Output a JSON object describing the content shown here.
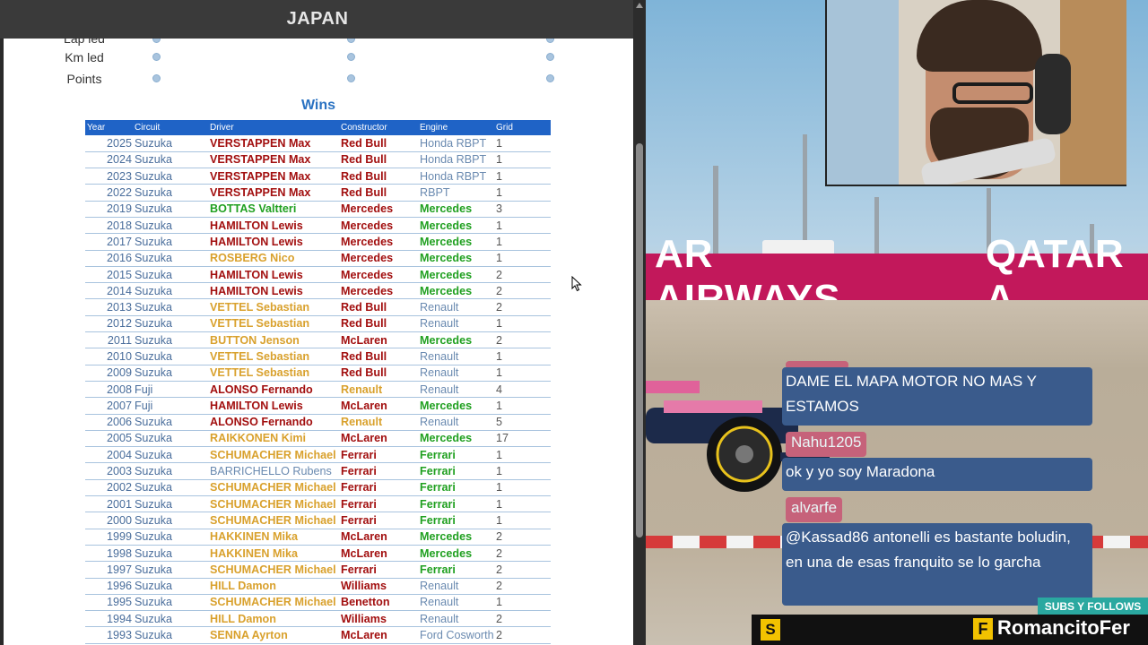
{
  "page": {
    "title": "JAPAN",
    "partial_label": "Lap led",
    "stats_rows": [
      {
        "label": "Km led"
      },
      {
        "label": "Points"
      }
    ],
    "wins_title": "Wins"
  },
  "wins_table": {
    "headers": [
      "Year",
      "Circuit",
      "Driver",
      "Constructor",
      "Engine",
      "Grid"
    ],
    "rows": [
      {
        "year": "2025",
        "circuit": "Suzuka",
        "driver": "VERSTAPPEN Max",
        "dc": "red",
        "constructor": "Red Bull",
        "cc": "red",
        "engine": "Honda RBPT",
        "ec": "blue",
        "grid": "1"
      },
      {
        "year": "2024",
        "circuit": "Suzuka",
        "driver": "VERSTAPPEN Max",
        "dc": "red",
        "constructor": "Red Bull",
        "cc": "red",
        "engine": "Honda RBPT",
        "ec": "blue",
        "grid": "1"
      },
      {
        "year": "2023",
        "circuit": "Suzuka",
        "driver": "VERSTAPPEN Max",
        "dc": "red",
        "constructor": "Red Bull",
        "cc": "red",
        "engine": "Honda RBPT",
        "ec": "blue",
        "grid": "1"
      },
      {
        "year": "2022",
        "circuit": "Suzuka",
        "driver": "VERSTAPPEN Max",
        "dc": "red",
        "constructor": "Red Bull",
        "cc": "red",
        "engine": "RBPT",
        "ec": "blue",
        "grid": "1"
      },
      {
        "year": "2019",
        "circuit": "Suzuka",
        "driver": "BOTTAS Valtteri",
        "dc": "green",
        "constructor": "Mercedes",
        "cc": "red",
        "engine": "Mercedes",
        "ec": "green",
        "grid": "3"
      },
      {
        "year": "2018",
        "circuit": "Suzuka",
        "driver": "HAMILTON Lewis",
        "dc": "red",
        "constructor": "Mercedes",
        "cc": "red",
        "engine": "Mercedes",
        "ec": "green",
        "grid": "1"
      },
      {
        "year": "2017",
        "circuit": "Suzuka",
        "driver": "HAMILTON Lewis",
        "dc": "red",
        "constructor": "Mercedes",
        "cc": "red",
        "engine": "Mercedes",
        "ec": "green",
        "grid": "1"
      },
      {
        "year": "2016",
        "circuit": "Suzuka",
        "driver": "ROSBERG Nico",
        "dc": "gold",
        "constructor": "Mercedes",
        "cc": "red",
        "engine": "Mercedes",
        "ec": "green",
        "grid": "1"
      },
      {
        "year": "2015",
        "circuit": "Suzuka",
        "driver": "HAMILTON Lewis",
        "dc": "red",
        "constructor": "Mercedes",
        "cc": "red",
        "engine": "Mercedes",
        "ec": "green",
        "grid": "2"
      },
      {
        "year": "2014",
        "circuit": "Suzuka",
        "driver": "HAMILTON Lewis",
        "dc": "red",
        "constructor": "Mercedes",
        "cc": "red",
        "engine": "Mercedes",
        "ec": "green",
        "grid": "2"
      },
      {
        "year": "2013",
        "circuit": "Suzuka",
        "driver": "VETTEL Sebastian",
        "dc": "gold",
        "constructor": "Red Bull",
        "cc": "red",
        "engine": "Renault",
        "ec": "blue",
        "grid": "2"
      },
      {
        "year": "2012",
        "circuit": "Suzuka",
        "driver": "VETTEL Sebastian",
        "dc": "gold",
        "constructor": "Red Bull",
        "cc": "red",
        "engine": "Renault",
        "ec": "blue",
        "grid": "1"
      },
      {
        "year": "2011",
        "circuit": "Suzuka",
        "driver": "BUTTON Jenson",
        "dc": "gold",
        "constructor": "McLaren",
        "cc": "red",
        "engine": "Mercedes",
        "ec": "green",
        "grid": "2"
      },
      {
        "year": "2010",
        "circuit": "Suzuka",
        "driver": "VETTEL Sebastian",
        "dc": "gold",
        "constructor": "Red Bull",
        "cc": "red",
        "engine": "Renault",
        "ec": "blue",
        "grid": "1"
      },
      {
        "year": "2009",
        "circuit": "Suzuka",
        "driver": "VETTEL Sebastian",
        "dc": "gold",
        "constructor": "Red Bull",
        "cc": "red",
        "engine": "Renault",
        "ec": "blue",
        "grid": "1"
      },
      {
        "year": "2008",
        "circuit": "Fuji",
        "driver": "ALONSO Fernando",
        "dc": "red",
        "constructor": "Renault",
        "cc": "gold",
        "engine": "Renault",
        "ec": "blue",
        "grid": "4"
      },
      {
        "year": "2007",
        "circuit": "Fuji",
        "driver": "HAMILTON Lewis",
        "dc": "red",
        "constructor": "McLaren",
        "cc": "red",
        "engine": "Mercedes",
        "ec": "green",
        "grid": "1"
      },
      {
        "year": "2006",
        "circuit": "Suzuka",
        "driver": "ALONSO Fernando",
        "dc": "red",
        "constructor": "Renault",
        "cc": "gold",
        "engine": "Renault",
        "ec": "blue",
        "grid": "5"
      },
      {
        "year": "2005",
        "circuit": "Suzuka",
        "driver": "RAIKKONEN Kimi",
        "dc": "gold",
        "constructor": "McLaren",
        "cc": "red",
        "engine": "Mercedes",
        "ec": "green",
        "grid": "17"
      },
      {
        "year": "2004",
        "circuit": "Suzuka",
        "driver": "SCHUMACHER Michael",
        "dc": "gold",
        "constructor": "Ferrari",
        "cc": "red",
        "engine": "Ferrari",
        "ec": "green",
        "grid": "1"
      },
      {
        "year": "2003",
        "circuit": "Suzuka",
        "driver": "BARRICHELLO Rubens",
        "dc": "blue",
        "constructor": "Ferrari",
        "cc": "red",
        "engine": "Ferrari",
        "ec": "green",
        "grid": "1"
      },
      {
        "year": "2002",
        "circuit": "Suzuka",
        "driver": "SCHUMACHER Michael",
        "dc": "gold",
        "constructor": "Ferrari",
        "cc": "red",
        "engine": "Ferrari",
        "ec": "green",
        "grid": "1"
      },
      {
        "year": "2001",
        "circuit": "Suzuka",
        "driver": "SCHUMACHER Michael",
        "dc": "gold",
        "constructor": "Ferrari",
        "cc": "red",
        "engine": "Ferrari",
        "ec": "green",
        "grid": "1"
      },
      {
        "year": "2000",
        "circuit": "Suzuka",
        "driver": "SCHUMACHER Michael",
        "dc": "gold",
        "constructor": "Ferrari",
        "cc": "red",
        "engine": "Ferrari",
        "ec": "green",
        "grid": "1"
      },
      {
        "year": "1999",
        "circuit": "Suzuka",
        "driver": "HAKKINEN Mika",
        "dc": "gold",
        "constructor": "McLaren",
        "cc": "red",
        "engine": "Mercedes",
        "ec": "green",
        "grid": "2"
      },
      {
        "year": "1998",
        "circuit": "Suzuka",
        "driver": "HAKKINEN Mika",
        "dc": "gold",
        "constructor": "McLaren",
        "cc": "red",
        "engine": "Mercedes",
        "ec": "green",
        "grid": "2"
      },
      {
        "year": "1997",
        "circuit": "Suzuka",
        "driver": "SCHUMACHER Michael",
        "dc": "gold",
        "constructor": "Ferrari",
        "cc": "red",
        "engine": "Ferrari",
        "ec": "green",
        "grid": "2"
      },
      {
        "year": "1996",
        "circuit": "Suzuka",
        "driver": "HILL Damon",
        "dc": "gold",
        "constructor": "Williams",
        "cc": "red",
        "engine": "Renault",
        "ec": "blue",
        "grid": "2"
      },
      {
        "year": "1995",
        "circuit": "Suzuka",
        "driver": "SCHUMACHER Michael",
        "dc": "gold",
        "constructor": "Benetton",
        "cc": "red",
        "engine": "Renault",
        "ec": "blue",
        "grid": "1"
      },
      {
        "year": "1994",
        "circuit": "Suzuka",
        "driver": "HILL Damon",
        "dc": "gold",
        "constructor": "Williams",
        "cc": "red",
        "engine": "Renault",
        "ec": "blue",
        "grid": "2"
      },
      {
        "year": "1993",
        "circuit": "Suzuka",
        "driver": "SENNA Ayrton",
        "dc": "gold",
        "constructor": "McLaren",
        "cc": "red",
        "engine": "Ford Cosworth",
        "ec": "blue",
        "grid": "2"
      }
    ]
  },
  "stream": {
    "billboard_left": "AR AIRWAYS",
    "billboard_right": "QATAR A",
    "chat": [
      {
        "user": "",
        "message": "DAME EL MAPA MOTOR NO MAS Y ESTAMOS"
      },
      {
        "user": "Nahu1205",
        "message": "ok y yo soy Maradona"
      },
      {
        "user": "alvarfe",
        "message": "@Kassad86 antonelli es bastante boludin, en una de esas franquito se lo garcha"
      }
    ],
    "subs_label": "SUBS Y FOLLOWS",
    "s_icon": "S",
    "f_icon": "F",
    "channel_name": "RomancitoFer"
  },
  "colors": {
    "header_blue": "#1f63c6",
    "title_blue": "#2a72c2",
    "driver_red": "#a20f0f",
    "engine_green": "#20a020",
    "champion_gold": "#d9a12d",
    "chat_bg": "#3a5b8c",
    "chat_user_bg": "#c6627a",
    "billboard": "#c2185b"
  }
}
